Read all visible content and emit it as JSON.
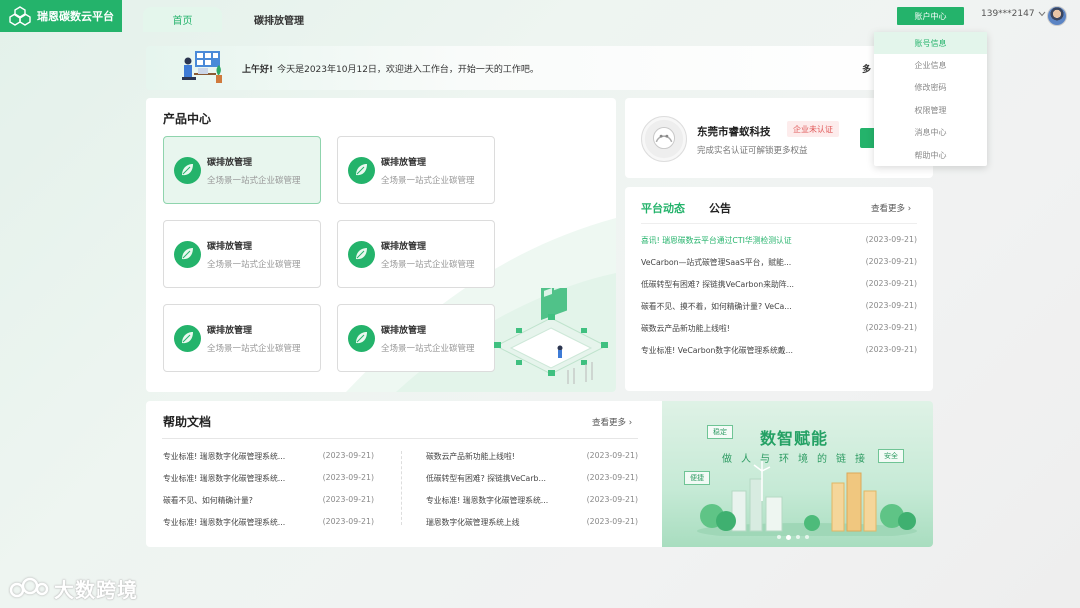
{
  "header": {
    "brand": "瑞恩碳数云平台",
    "tabs": [
      {
        "label": "首页"
      },
      {
        "label": "碳排放管理"
      }
    ],
    "account_button": "账户中心",
    "phone": "139***2147"
  },
  "account_menu": {
    "items": [
      {
        "label": "账号信息"
      },
      {
        "label": "企业信息"
      },
      {
        "label": "修改密码"
      },
      {
        "label": "权限管理"
      },
      {
        "label": "消息中心"
      },
      {
        "label": "帮助中心"
      }
    ]
  },
  "welcome": {
    "greeting": "上午好!",
    "message": "今天是2023年10月12日，欢迎进入工作台，开始一天的工作吧。",
    "more": "多"
  },
  "product_center": {
    "title": "产品中心",
    "cards": [
      {
        "name": "碳排放管理",
        "desc": "全场景一站式企业碳管理"
      },
      {
        "name": "碳排放管理",
        "desc": "全场景一站式企业碳管理"
      },
      {
        "name": "碳排放管理",
        "desc": "全场景一站式企业碳管理"
      },
      {
        "name": "碳排放管理",
        "desc": "全场景一站式企业碳管理"
      },
      {
        "name": "碳排放管理",
        "desc": "全场景一站式企业碳管理"
      },
      {
        "name": "碳排放管理",
        "desc": "全场景一站式企业碳管理"
      }
    ]
  },
  "company": {
    "name": "东莞市睿蚁科技",
    "badge": "企业未认证",
    "subtitle": "完成实名认证可解锁更多权益"
  },
  "news": {
    "tabs": [
      {
        "label": "平台动态"
      },
      {
        "label": "公告"
      }
    ],
    "more": "查看更多",
    "items": [
      {
        "title": "喜讯! 瑞恩碳数云平台通过CTI华测检测认证",
        "date": "(2023-09-21)"
      },
      {
        "title": "VeCarbon—站式碳管理SaaS平台，赋能...",
        "date": "(2023-09-21)"
      },
      {
        "title": "低碳转型有困难? 探链携VeCarbon来助阵...",
        "date": "(2023-09-21)"
      },
      {
        "title": "碳看不见、摸不着，如何精确计量? VeCa...",
        "date": "(2023-09-21)"
      },
      {
        "title": "碳数云产品新功能上线啦!",
        "date": "(2023-09-21)"
      },
      {
        "title": "专业标准! VeCarbon数字化碳管理系统戴...",
        "date": "(2023-09-21)"
      }
    ]
  },
  "help_docs": {
    "title": "帮助文档",
    "more": "查看更多",
    "left": [
      {
        "title": "专业标准! 瑞恩数字化碳管理系统...",
        "date": "(2023-09-21)"
      },
      {
        "title": "专业标准! 瑞恩数字化碳管理系统...",
        "date": "(2023-09-21)"
      },
      {
        "title": "碳看不见、如何精确计量?",
        "date": "(2023-09-21)"
      },
      {
        "title": "专业标准! 瑞恩数字化碳管理系统...",
        "date": "(2023-09-21)"
      }
    ],
    "right": [
      {
        "title": "碳数云产品新功能上线啦!",
        "date": "(2023-09-21)"
      },
      {
        "title": "低碳转型有困难? 探链携VeCarb...",
        "date": "(2023-09-21)"
      },
      {
        "title": "专业标准! 瑞恩数字化碳管理系统...",
        "date": "(2023-09-21)"
      },
      {
        "title": "瑞恩数字化碳管理系统上线",
        "date": "(2023-09-21)"
      }
    ]
  },
  "banner": {
    "title": "数智赋能",
    "subtitle": "做人与环境的链接",
    "tags": [
      {
        "label": "稳定"
      },
      {
        "label": "安全"
      },
      {
        "label": "便捷"
      }
    ],
    "active_slide": 2,
    "slides": 4
  },
  "watermark": "大数跨境",
  "colors": {
    "brand": "#24b36b",
    "badge_red": "#e05656"
  }
}
